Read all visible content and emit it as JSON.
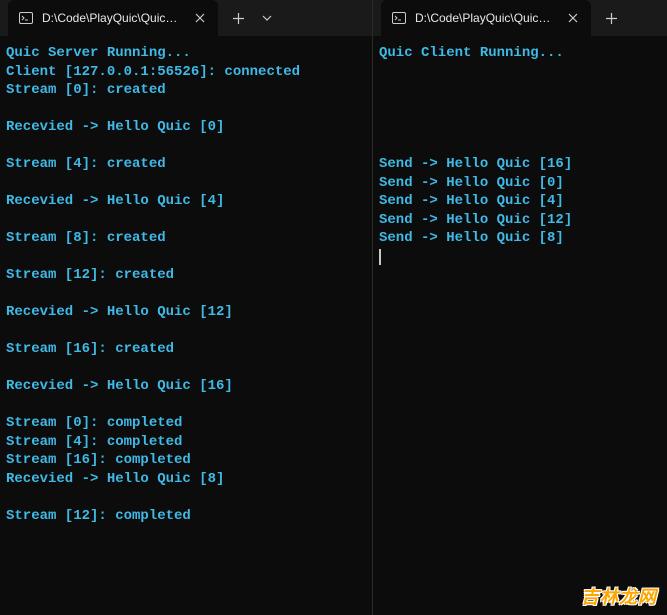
{
  "left": {
    "tab": {
      "title": "D:\\Code\\PlayQuic\\QuicServer"
    },
    "lines": [
      "Quic Server Running...",
      "Client [127.0.0.1:56526]: connected",
      "Stream [0]: created",
      "",
      "Recevied -> Hello Quic [0]",
      "",
      "Stream [4]: created",
      "",
      "Recevied -> Hello Quic [4]",
      "",
      "Stream [8]: created",
      "",
      "Stream [12]: created",
      "",
      "Recevied -> Hello Quic [12]",
      "",
      "Stream [16]: created",
      "",
      "Recevied -> Hello Quic [16]",
      "",
      "Stream [0]: completed",
      "Stream [4]: completed",
      "Stream [16]: completed",
      "Recevied -> Hello Quic [8]",
      "",
      "Stream [12]: completed"
    ]
  },
  "right": {
    "tab": {
      "title": "D:\\Code\\PlayQuic\\QuicClient\\"
    },
    "lines": [
      "Quic Client Running...",
      "",
      "",
      "",
      "",
      "",
      "Send -> Hello Quic [16]",
      "Send -> Hello Quic [0]",
      "Send -> Hello Quic [4]",
      "Send -> Hello Quic [12]",
      "Send -> Hello Quic [8]"
    ]
  },
  "watermark": "吉林龙网"
}
